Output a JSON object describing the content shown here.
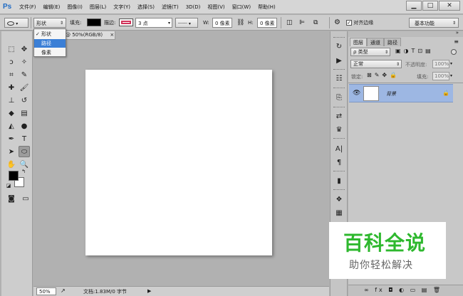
{
  "app": {
    "logo": "Ps"
  },
  "menu": [
    "文件(F)",
    "编辑(E)",
    "图像(I)",
    "图层(L)",
    "文字(Y)",
    "选择(S)",
    "滤镜(T)",
    "3D(D)",
    "视图(V)",
    "窗口(W)",
    "帮助(H)"
  ],
  "window_buttons": {
    "minimize": "▁",
    "maximize": "□",
    "close": "✕"
  },
  "options": {
    "mode_value": "形状",
    "fill_label": "填充:",
    "stroke_label": "描边:",
    "stroke_width": "3 点",
    "w_label": "W:",
    "w_value": "0 像素",
    "h_label": "H:",
    "h_value": "0 像素",
    "align_edges": "对齐边缘",
    "workspace": "基本功能",
    "fill_color": "#000000",
    "stroke_color": "#d0345a"
  },
  "dropdown": {
    "items": [
      {
        "label": "形状",
        "checked": "✓"
      },
      {
        "label": "路径"
      },
      {
        "label": "像素"
      }
    ]
  },
  "document": {
    "tab_title": "@ 50%(RGB/8)",
    "tab_close": "×",
    "zoom": "50%",
    "doc_info": "文档:1.83M/0 字节"
  },
  "layers_panel": {
    "tabs": [
      "图层",
      "通道",
      "路径"
    ],
    "kind_label": "ρ 类型",
    "blend_mode": "正常",
    "opacity_label": "不透明度:",
    "opacity_value": "100%",
    "lock_label": "锁定:",
    "fill_label": "填充:",
    "fill_value": "100%",
    "layer_name": "背景",
    "bottom_icons": "∞  fx  ◘  ◐  ▭  ▤  🗑"
  },
  "watermark": {
    "title": "百科全说",
    "subtitle": "助你轻松解决",
    "title_color": "#2eb82e"
  }
}
